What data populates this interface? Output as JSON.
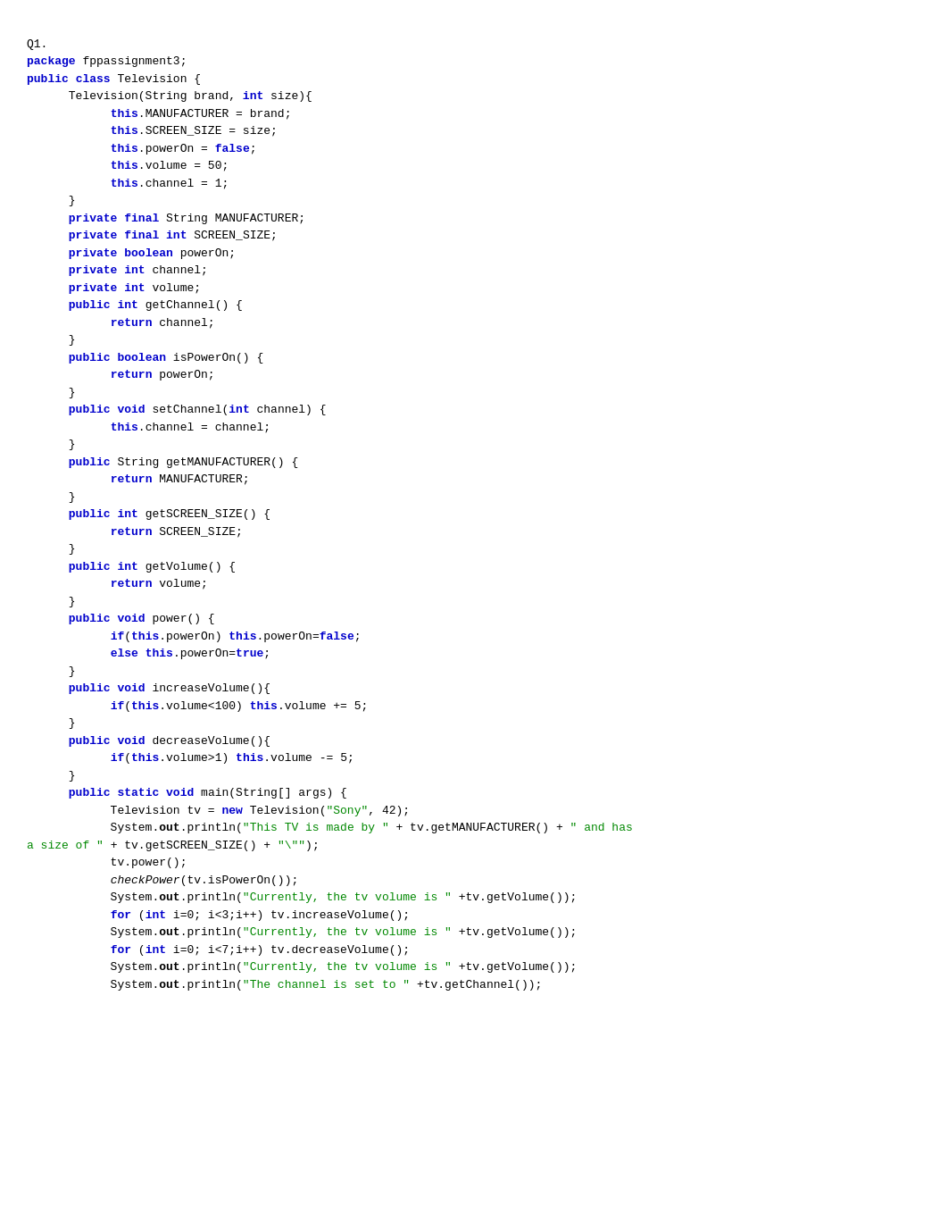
{
  "code": {
    "label": "Q1.",
    "lines": []
  }
}
